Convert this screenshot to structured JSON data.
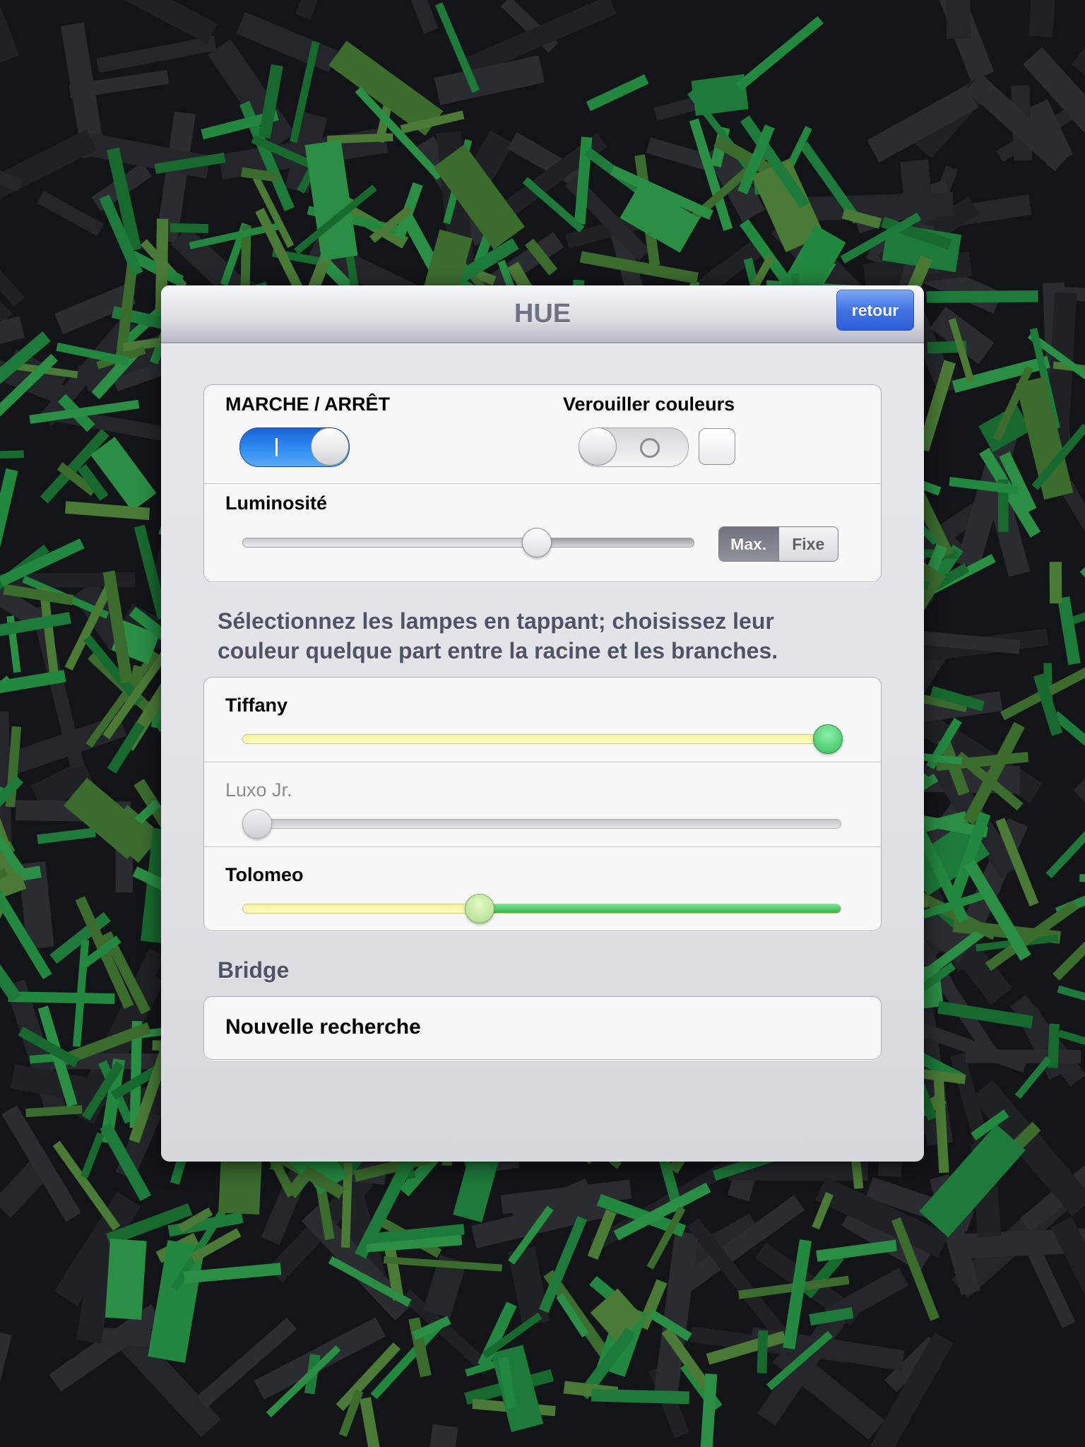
{
  "navbar": {
    "title": "HUE",
    "back_label": "retour"
  },
  "power": {
    "label": "MARCHE / ARRÊT",
    "on": true
  },
  "lock": {
    "label": "Verouiller couleurs",
    "on": false,
    "checked": false
  },
  "brightness": {
    "label": "Luminosité",
    "value": 0.66,
    "segment": {
      "options": [
        "Max.",
        "Fixe"
      ],
      "selected": "Max."
    }
  },
  "instructions": "Sélectionnez les lampes en tappant; choisissez leur couleur quelque part entre la racine et les branches.",
  "lamps": [
    {
      "name": "Tiffany",
      "value": 1.0,
      "enabled": true
    },
    {
      "name": "Luxo Jr.",
      "value": 0.0,
      "enabled": false
    },
    {
      "name": "Tolomeo",
      "value": 0.39,
      "enabled": true
    }
  ],
  "bridge": {
    "header": "Bridge",
    "new_search_label": "Nouvelle recherche"
  },
  "colors": {
    "accent_blue": "#2f8ef4",
    "hue_yellow": "#fbfbb0",
    "hue_green": "#3cc35a",
    "background": "#131418",
    "foliage_green": "#1d7a3a"
  }
}
